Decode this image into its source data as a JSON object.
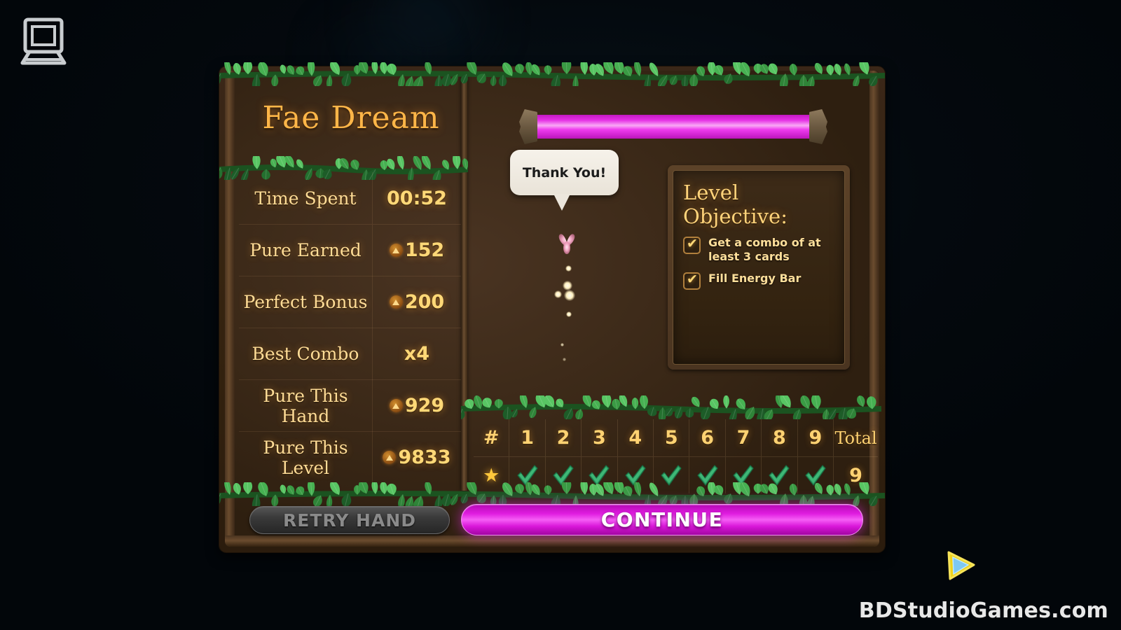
{
  "window": {
    "laptop_icon": "laptop-icon",
    "background_color": "#050d12"
  },
  "panel": {
    "title": "Fae Dream"
  },
  "stats": {
    "rows": [
      {
        "label": "Time Spent",
        "value": "00:52",
        "coin": false
      },
      {
        "label": "Pure Earned",
        "value": "152",
        "coin": true
      },
      {
        "label": "Perfect Bonus",
        "value": "200",
        "coin": true
      },
      {
        "label": "Best Combo",
        "value": "x4",
        "coin": false
      },
      {
        "label": "Pure This Hand",
        "value": "929",
        "coin": true
      },
      {
        "label": "Pure This Level",
        "value": "9833",
        "coin": true
      }
    ]
  },
  "energy_bar": {
    "label": "energy-bar",
    "fill_percent": 100,
    "fill_color": "#e52ee5"
  },
  "speech_bubble": {
    "text": "Thank You!"
  },
  "fairy": {
    "icon": "fairy-sprite",
    "color": "#f0a8c0"
  },
  "objective": {
    "title": "Level Objective:",
    "items": [
      {
        "text": "Get a combo of at least 3 cards",
        "checked": true
      },
      {
        "text": "Fill Energy Bar",
        "checked": true
      }
    ]
  },
  "score_grid": {
    "headers": [
      "#",
      "1",
      "2",
      "3",
      "4",
      "5",
      "6",
      "7",
      "8",
      "9",
      "Total"
    ],
    "row_icon": "star-icon",
    "cells": [
      "✔",
      "✔",
      "✔",
      "✔",
      "✔",
      "✔",
      "✔",
      "✔",
      "✔"
    ],
    "total": "9"
  },
  "buttons": {
    "retry": "RETRY HAND",
    "retry_disabled": true,
    "continue": "CONTINUE",
    "continue_color": "#e01de0"
  },
  "cursor": {
    "icon": "play-cursor-icon"
  },
  "watermark": {
    "text": "BDStudioGames.com"
  }
}
